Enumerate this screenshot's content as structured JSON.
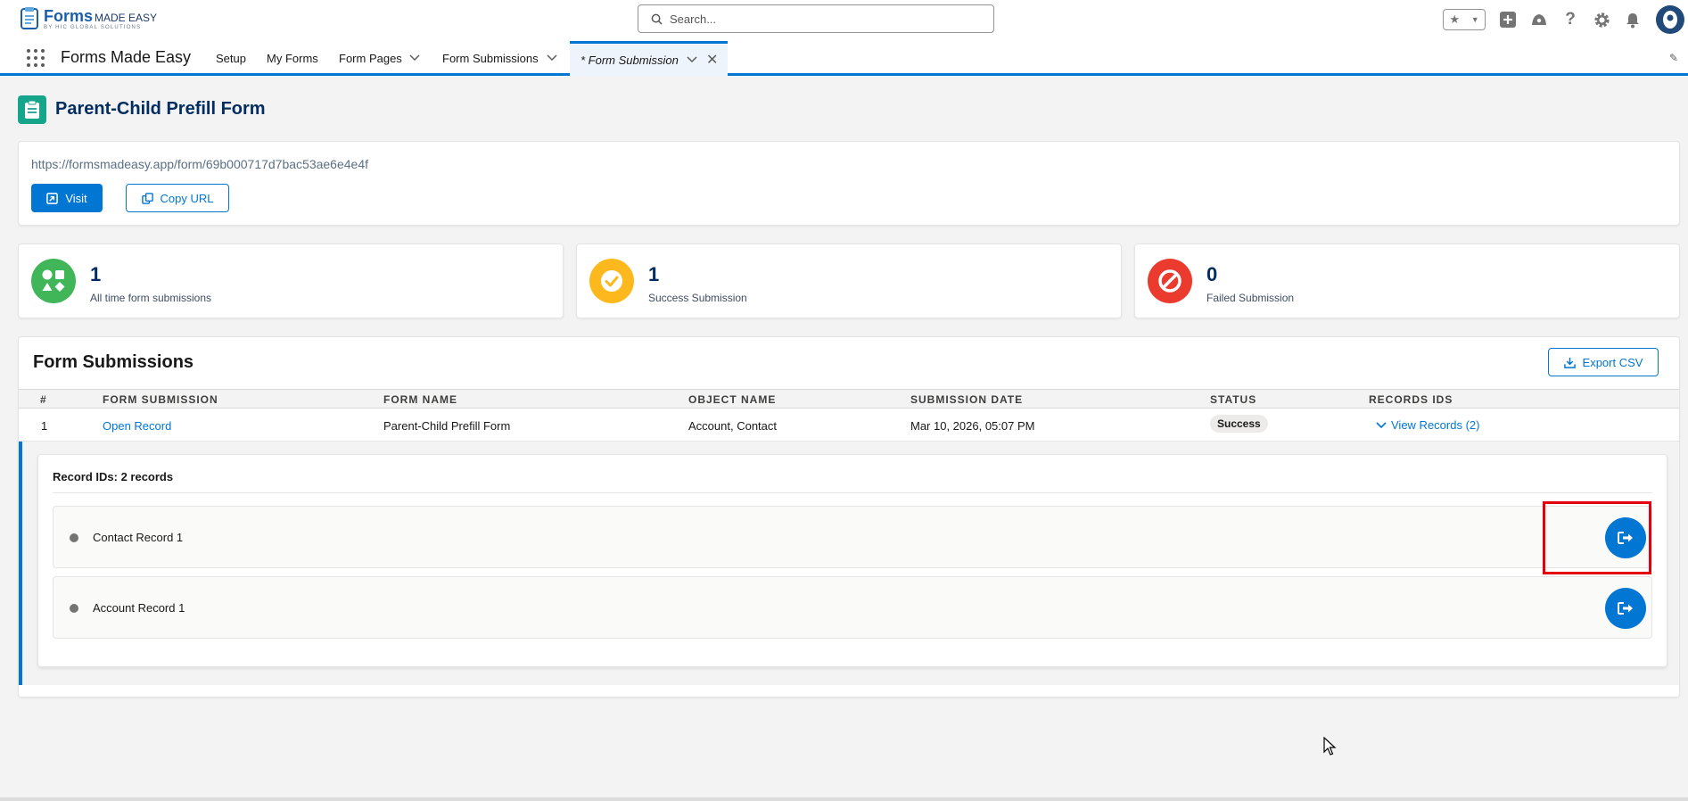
{
  "global_header": {
    "logo": {
      "main": "Forms",
      "main_small": "MADE EASY",
      "sub": "BY HIC GLOBAL SOLUTIONS"
    },
    "search_placeholder": "Search...",
    "icons": [
      "favorites-star-icon",
      "add-icon",
      "trailhead-icon",
      "help-icon",
      "setup-gear-icon",
      "notifications-bell-icon",
      "user-avatar"
    ]
  },
  "app_nav": {
    "app_name": "Forms Made Easy",
    "items": [
      "Setup",
      "My Forms",
      "Form Pages",
      "Form Submissions"
    ],
    "active_tab": "* Form Submission"
  },
  "page": {
    "title": "Parent-Child Prefill Form",
    "url": "https://formsmadeasy.app/form/69b000717d7bac53ae6e4e4f",
    "visit_label": "Visit",
    "copy_label": "Copy URL"
  },
  "stats": [
    {
      "value": "1",
      "label": "All time form submissions",
      "color": "#2e844a"
    },
    {
      "value": "1",
      "label": "Success Submission",
      "color": "#fcb81c"
    },
    {
      "value": "0",
      "label": "Failed Submission",
      "color": "#ea001e"
    }
  ],
  "submissions": {
    "title": "Form Submissions",
    "export_label": "Export CSV",
    "columns": [
      "#",
      "FORM SUBMISSION",
      "FORM NAME",
      "OBJECT NAME",
      "SUBMISSION DATE",
      "STATUS",
      "RECORDS IDS"
    ],
    "rows": [
      {
        "num": "1",
        "submission": "Open Record",
        "form_name": "Parent-Child Prefill Form",
        "object_name": "Account, Contact",
        "date": "Mar 10, 2026, 05:07 PM",
        "status": "Success",
        "records": "View Records (2)"
      }
    ],
    "records_panel": {
      "title": "Record IDs: 2 records",
      "records": [
        {
          "label": "Contact Record 1"
        },
        {
          "label": "Account Record 1"
        }
      ]
    }
  },
  "colors": {
    "brand": "#0176d3",
    "title": "#032d60",
    "highlight": "#e3000f"
  }
}
